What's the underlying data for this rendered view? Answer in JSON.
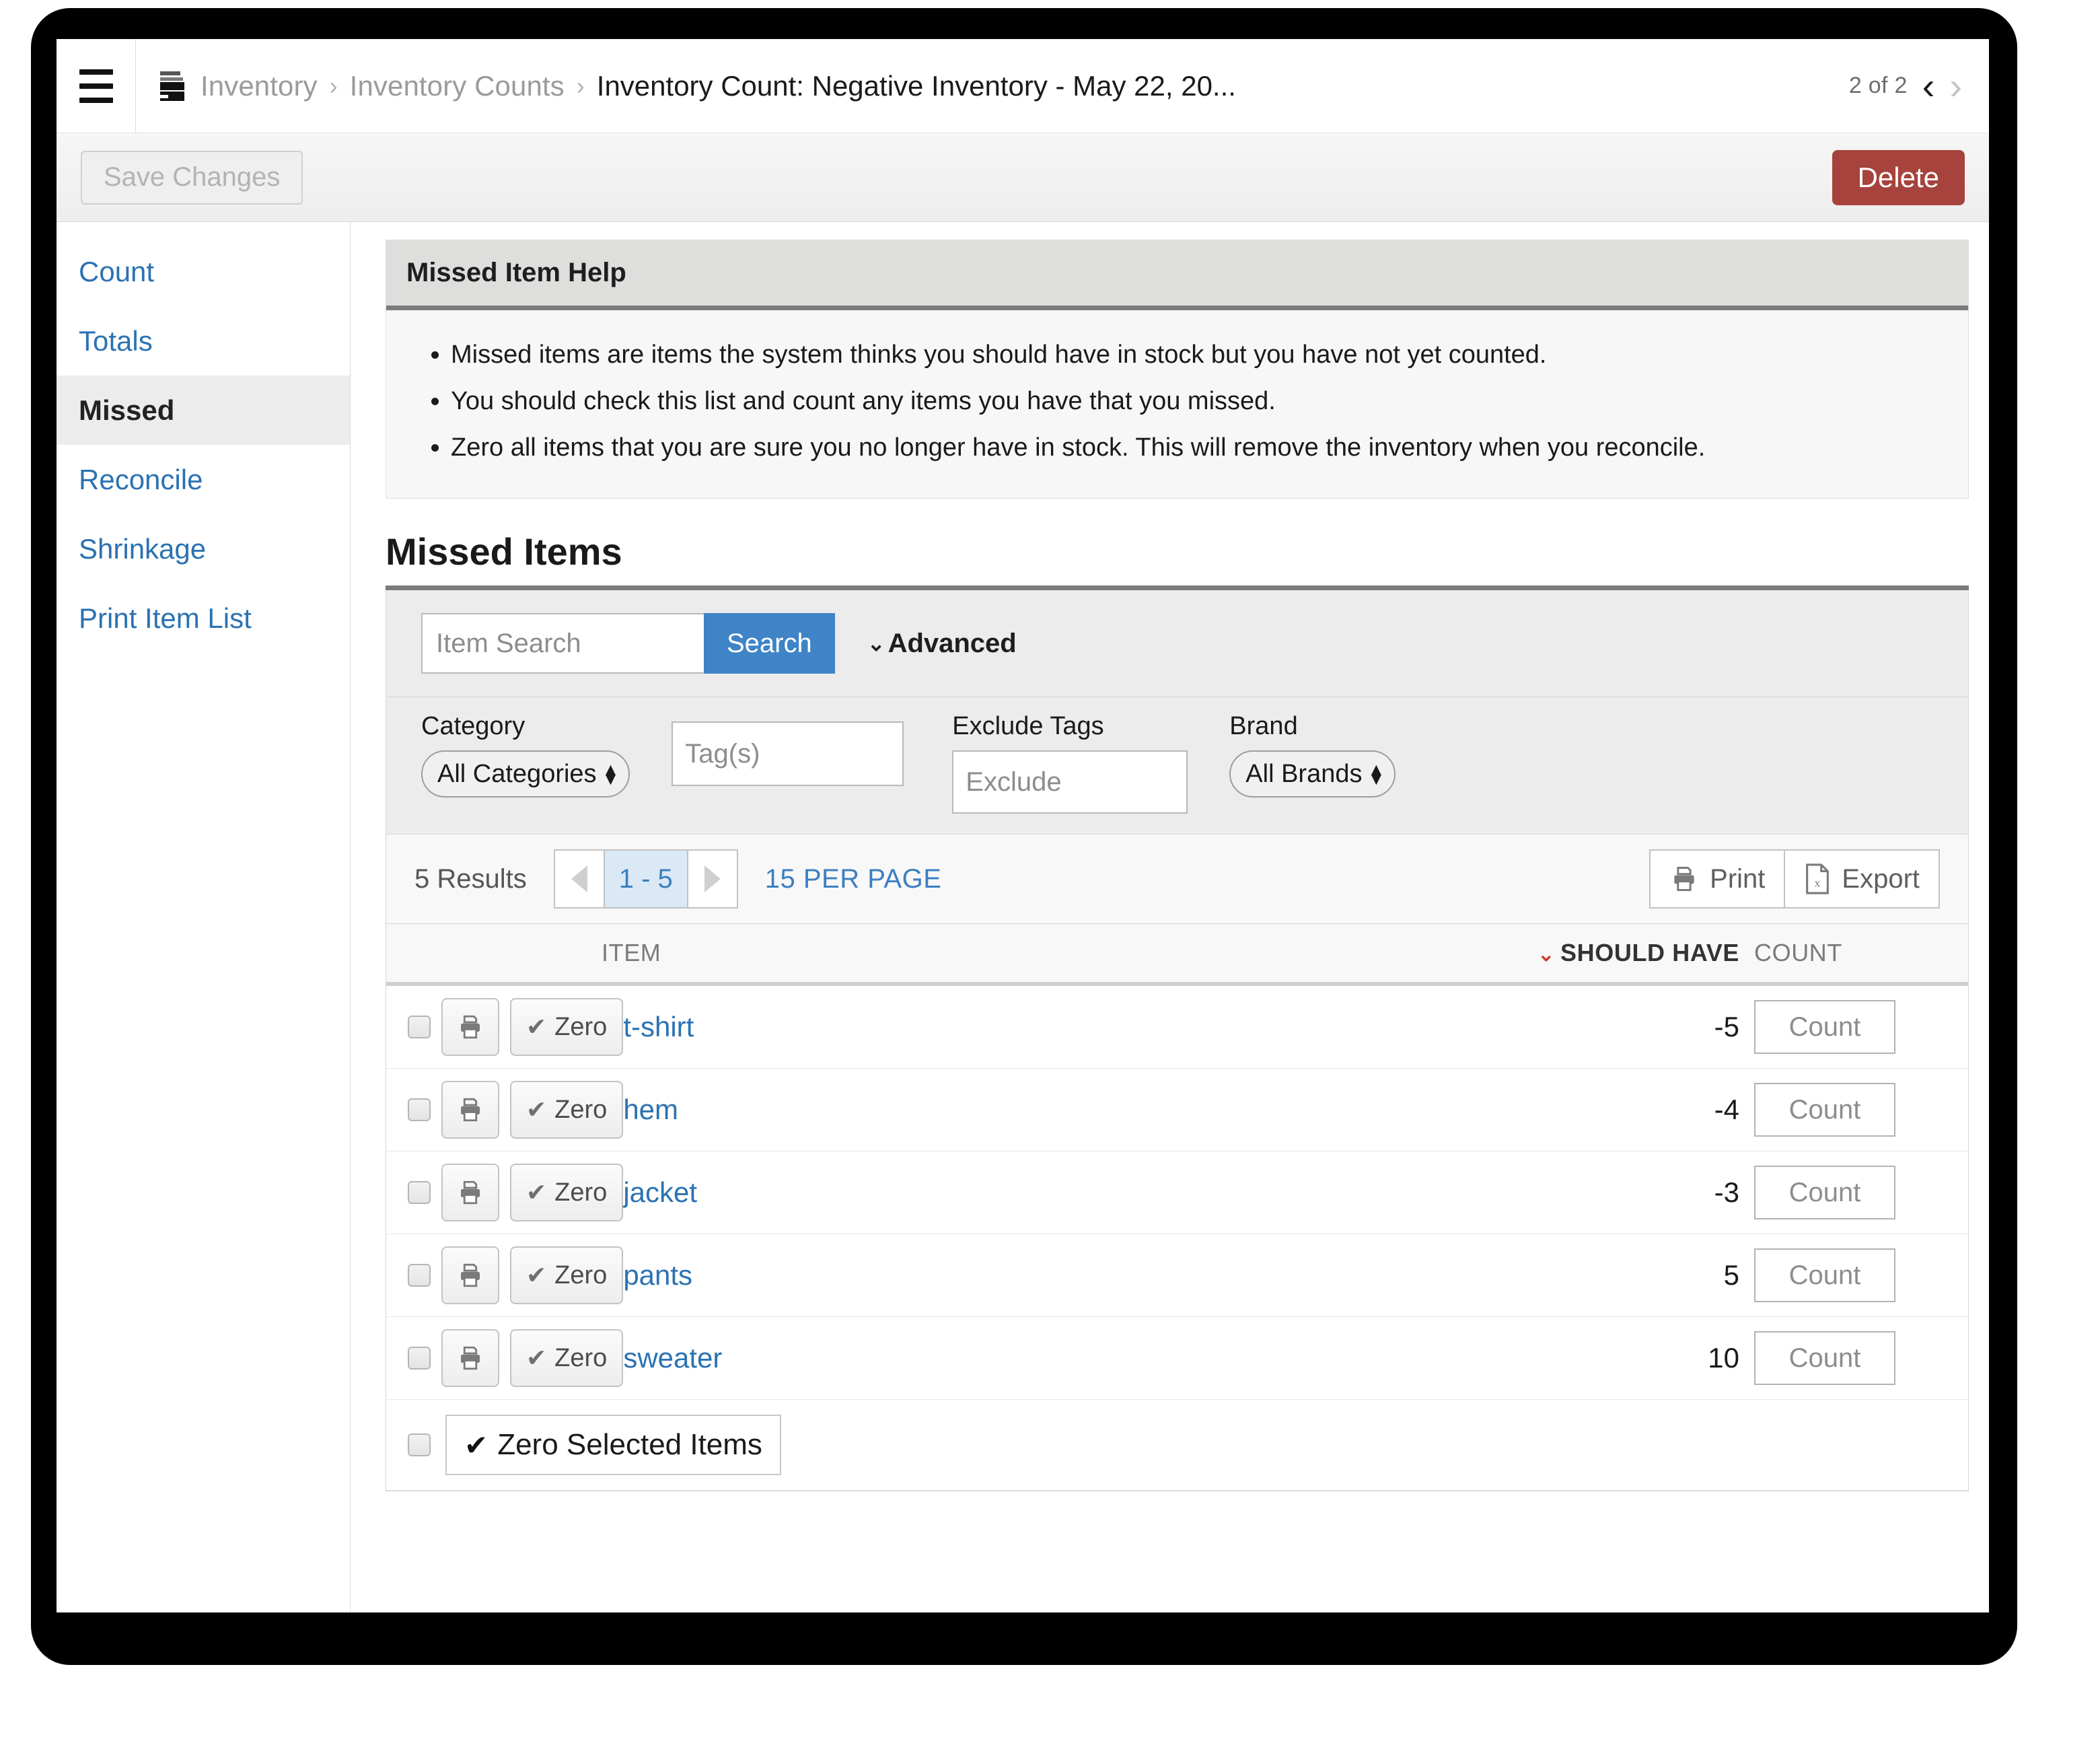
{
  "header": {
    "menu_icon": "hamburger-icon",
    "breadcrumb_icon": "inventory-box-icon",
    "breadcrumb": [
      {
        "label": "Inventory"
      },
      {
        "label": "Inventory Counts"
      }
    ],
    "separator": "›",
    "current": "Inventory Count: Negative Inventory - May 22, 20...",
    "pager_label": "2 of 2",
    "prev_icon": "chevron-left-icon",
    "next_icon": "chevron-right-icon",
    "prev_glyph": "‹",
    "next_glyph": "›"
  },
  "toolbar": {
    "save_label": "Save Changes",
    "delete_label": "Delete",
    "delete_color": "#a6433d"
  },
  "sidebar": {
    "items": [
      {
        "label": "Count",
        "active": false
      },
      {
        "label": "Totals",
        "active": false
      },
      {
        "label": "Missed",
        "active": true
      },
      {
        "label": "Reconcile",
        "active": false
      },
      {
        "label": "Shrinkage",
        "active": false
      },
      {
        "label": "Print Item List",
        "active": false
      }
    ]
  },
  "help": {
    "title": "Missed Item Help",
    "bullets": [
      "Missed items are items the system thinks you should have in stock but you have not yet counted.",
      "You should check this list and count any items you have that you missed.",
      "Zero all items that you are sure you no longer have in stock. This will remove the inventory when you reconcile."
    ]
  },
  "missed": {
    "section_title": "Missed Items",
    "search": {
      "placeholder": "Item Search",
      "value": "",
      "button_label": "Search",
      "advanced_label": "Advanced",
      "advanced_caret": "⌄"
    },
    "filters": {
      "category_label": "Category",
      "category_value": "All Categories",
      "tags_placeholder": "Tag(s)",
      "tags_value": "",
      "exclude_tags_label": "Exclude Tags",
      "exclude_placeholder": "Exclude",
      "exclude_value": "",
      "brand_label": "Brand",
      "brand_value": "All Brands"
    },
    "results": {
      "count_label": "5 Results",
      "page_range": "1 - 5",
      "per_page_label": "15 PER PAGE",
      "print_label": "Print",
      "export_label": "Export",
      "print_icon": "printer-icon",
      "export_icon": "excel-file-icon",
      "prev_page_icon": "triangle-left-icon",
      "next_page_icon": "triangle-right-icon"
    },
    "table": {
      "columns": {
        "item": "ITEM",
        "should_have": "SHOULD HAVE",
        "count": "COUNT"
      },
      "sort_caret": "⌄",
      "sort_caret_color": "#d03b2f",
      "row_print_icon": "printer-icon",
      "row_zero_label": "Zero",
      "row_zero_tick": "✔",
      "count_placeholder": "Count",
      "rows": [
        {
          "item": "t-shirt",
          "should_have": "-5",
          "count": ""
        },
        {
          "item": "hem",
          "should_have": "-4",
          "count": ""
        },
        {
          "item": "jacket",
          "should_have": "-3",
          "count": ""
        },
        {
          "item": "pants",
          "should_have": "5",
          "count": ""
        },
        {
          "item": "sweater",
          "should_have": "10",
          "count": ""
        }
      ]
    },
    "footer": {
      "zero_selected_label": "Zero Selected Items",
      "zero_selected_tick": "✔"
    }
  }
}
